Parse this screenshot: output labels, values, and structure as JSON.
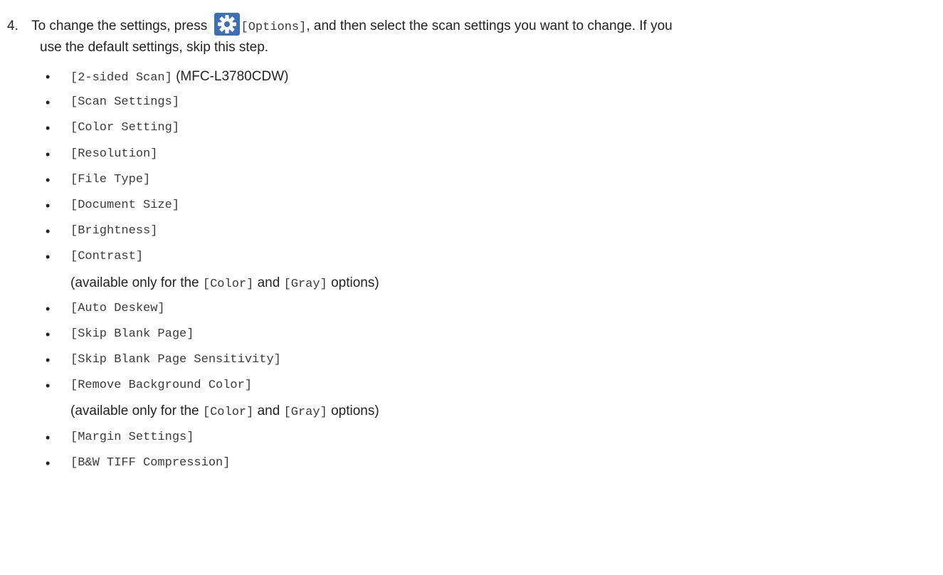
{
  "step": {
    "number": "4.",
    "line1_before_icon": "To change the settings, press ",
    "line1_icon_label": "[Options]",
    "line1_after_icon": ", and then select the scan settings you want to change. If you",
    "line2": "use the default settings, skip this step.",
    "icon": "gear-icon",
    "icon_color": "#3d6fb6"
  },
  "settings": [
    {
      "label": "[2-sided Scan]",
      "suffix": " (MFC-L3780CDW)"
    },
    {
      "label": "[Scan Settings]"
    },
    {
      "label": "[Color Setting]"
    },
    {
      "label": "[Resolution]"
    },
    {
      "label": "[File Type]"
    },
    {
      "label": "[Document Size]"
    },
    {
      "label": "[Brightness]"
    },
    {
      "label": "[Contrast]"
    },
    {
      "label": "[Auto Deskew]"
    },
    {
      "label": "[Skip Blank Page]"
    },
    {
      "label": "[Skip Blank Page Sensitivity]"
    },
    {
      "label": "[Remove Background Color]"
    },
    {
      "label": "[Margin Settings]"
    },
    {
      "label": "[B&W TIFF Compression]"
    }
  ],
  "availability_note": {
    "prefix": "(available only for the ",
    "option1": "[Color]",
    "middle": " and ",
    "option2": "[Gray]",
    "suffix": " options)"
  },
  "bullet_char": "•"
}
